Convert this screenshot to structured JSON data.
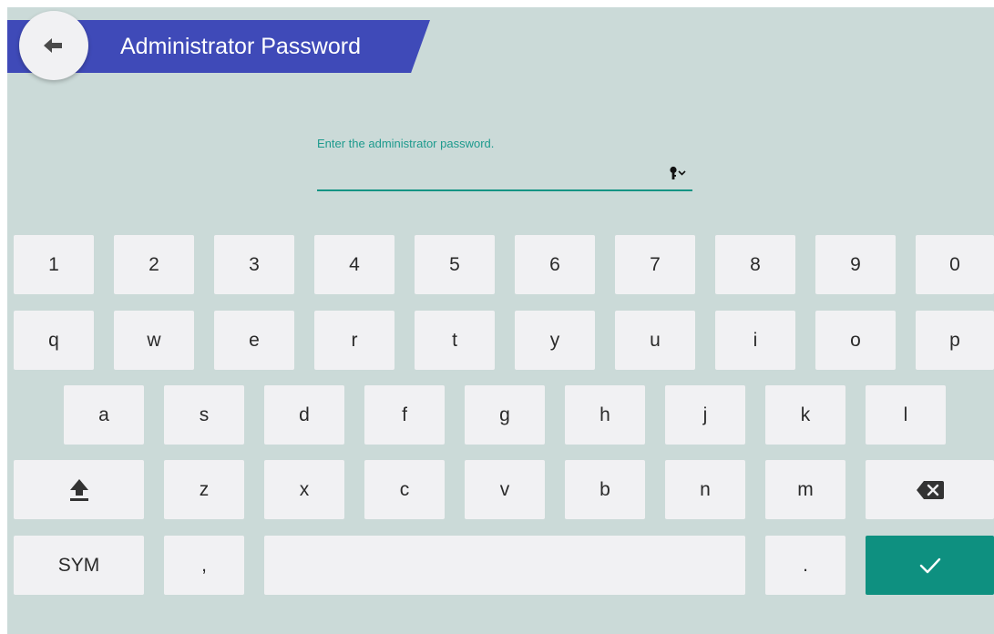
{
  "header": {
    "title": "Administrator Password",
    "back_icon": "arrow-left-icon",
    "banner_color": "#3f4ab8"
  },
  "password": {
    "label": "Enter the administrator password.",
    "value": "",
    "toggle_icon": "key-visibility-icon",
    "accent_color": "#149484"
  },
  "keyboard": {
    "row1": [
      "1",
      "2",
      "3",
      "4",
      "5",
      "6",
      "7",
      "8",
      "9",
      "0"
    ],
    "row2": [
      "q",
      "w",
      "e",
      "r",
      "t",
      "y",
      "u",
      "i",
      "o",
      "p"
    ],
    "row3": [
      "a",
      "s",
      "d",
      "f",
      "g",
      "h",
      "j",
      "k",
      "l"
    ],
    "row4": [
      "z",
      "x",
      "c",
      "v",
      "b",
      "n",
      "m"
    ],
    "shift_icon": "shift-icon",
    "backspace_icon": "backspace-icon",
    "sym_label": "SYM",
    "comma_label": ",",
    "period_label": ".",
    "enter_icon": "checkmark-icon",
    "enter_color": "#0e9080"
  }
}
